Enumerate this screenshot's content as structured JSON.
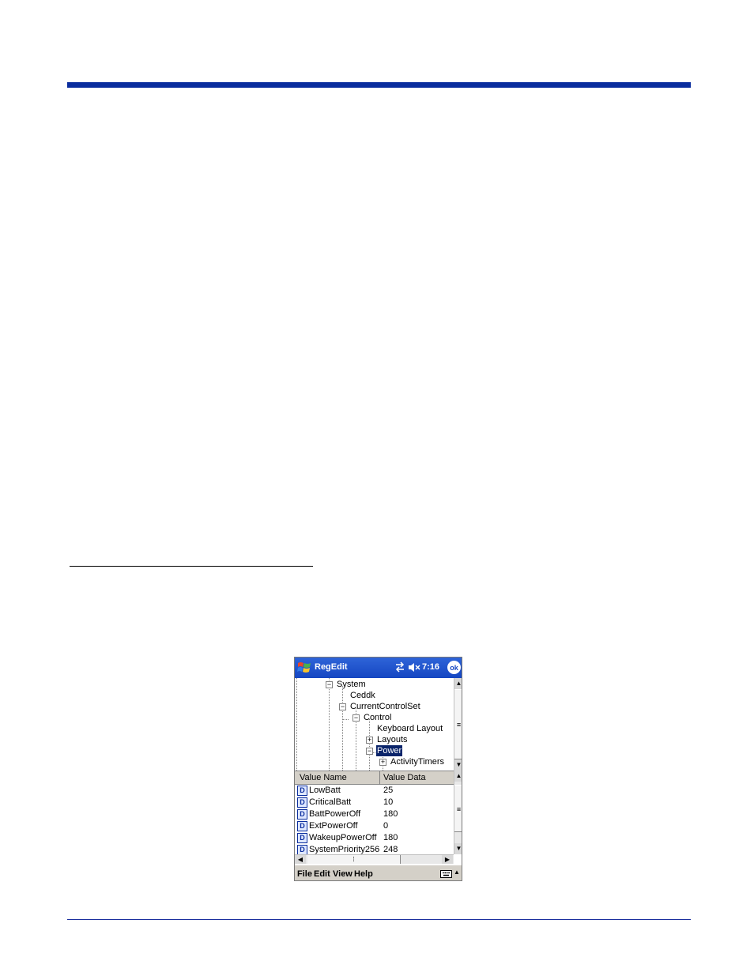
{
  "device_screen": {
    "title_bar": {
      "app_title": "RegEdit",
      "time": "7:16",
      "ok_label": "ok",
      "icons": [
        "windows-start-flag-icon",
        "connectivity-icon",
        "speaker-muted-icon"
      ]
    },
    "tree": {
      "nodes": [
        {
          "label": "System",
          "expander": "−"
        },
        {
          "label": "Ceddk"
        },
        {
          "label": "CurrentControlSet",
          "expander": "−"
        },
        {
          "label": "Control",
          "expander": "−"
        },
        {
          "label": "Keyboard Layout"
        },
        {
          "label": "Layouts",
          "expander": "+"
        },
        {
          "label": "Power",
          "expander": "−",
          "selected": true
        },
        {
          "label": "ActivityTimers",
          "expander": "+"
        }
      ]
    },
    "list": {
      "columns": [
        "Value Name",
        "Value Data"
      ],
      "icon_letter": "D",
      "rows": [
        {
          "name": "LowBatt",
          "data": "25"
        },
        {
          "name": "CriticalBatt",
          "data": "10"
        },
        {
          "name": "BattPowerOff",
          "data": "180"
        },
        {
          "name": "ExtPowerOff",
          "data": "0"
        },
        {
          "name": "WakeupPowerOff",
          "data": "180"
        },
        {
          "name": "SystemPriority256",
          "data": "248"
        }
      ]
    },
    "menu": {
      "items": [
        "File",
        "Edit",
        "View",
        "Help"
      ]
    },
    "glyphs": {
      "up": "▲",
      "down": "▼",
      "left": "◀",
      "right": "▶",
      "grip": "≡",
      "hgrip": "⁞"
    },
    "colors": {
      "title_bar": "#1546c2",
      "selection": "#0a246a",
      "page_rule": "#0a2d9e"
    }
  }
}
